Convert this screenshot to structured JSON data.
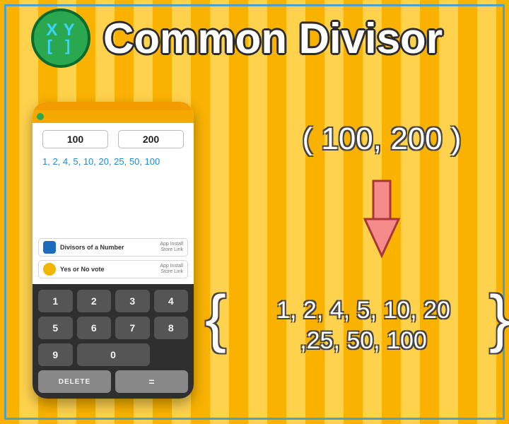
{
  "header": {
    "title": "Common Divisor",
    "logo_top": "X Y",
    "logo_bottom": "[  ]"
  },
  "pair_display": "( 100, 200 )",
  "result_line1": "1, 2, 4, 5, 10, 20",
  "result_line2": ",25, 50, 100",
  "phone": {
    "input_a": "100",
    "input_b": "200",
    "divisors_text": "1, 2, 4, 5, 10, 20, 25, 50, 100",
    "ads": [
      {
        "title": "Divisors of a Number",
        "sub1": "App Install",
        "sub2": "Store Link"
      },
      {
        "title": "Yes or No vote",
        "sub1": "App Install",
        "sub2": "Store Link"
      }
    ],
    "keys": {
      "k1": "1",
      "k2": "2",
      "k3": "3",
      "k4": "4",
      "k5": "5",
      "k6": "6",
      "k7": "7",
      "k8": "8",
      "k9": "9",
      "k0": "0",
      "del": "DELETE",
      "eq": "="
    }
  }
}
